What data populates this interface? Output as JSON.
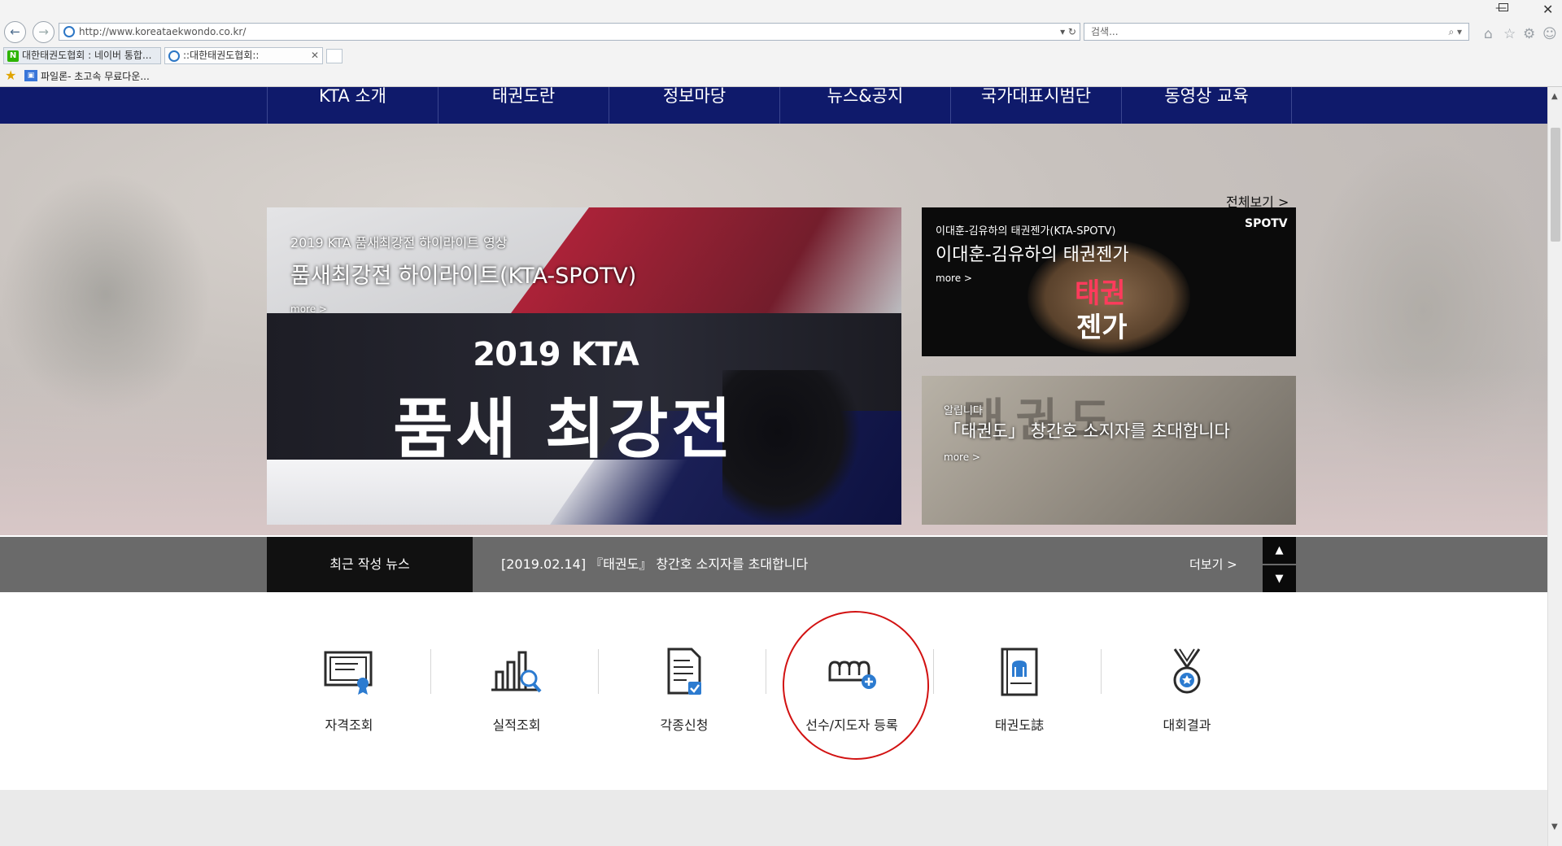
{
  "browser": {
    "url": "http://www.koreataekwondo.co.kr/",
    "search_placeholder": "검색...",
    "tabs": [
      {
        "label": "대한태권도협회 : 네이버 통합..."
      },
      {
        "label": "::대한태권도협회::"
      }
    ],
    "favorites": [
      {
        "label": "파일론- 초고속 무료다운..."
      }
    ]
  },
  "nav": {
    "items": [
      "KTA 소개",
      "태권도란",
      "정보마당",
      "뉴스&공지",
      "국가대표시범단",
      "동영상 교육"
    ]
  },
  "hero": {
    "view_all": "전체보기 >",
    "main": {
      "subtitle": "2019 KTA 품새최강전 하이라이트 영상",
      "title": "품새최강전 하이라이트(KTA-SPOTV)",
      "more": "more >",
      "graphic_line1": "2019 KTA",
      "graphic_line2": "품새 최강전"
    },
    "side1": {
      "logo": "SPOTV",
      "subtitle": "이대훈-김유하의 태권젠가(KTA-SPOTV)",
      "title": "이대훈-김유하의 태권젠가",
      "more": "more >",
      "art_line1": "태권",
      "art_line2": "젠가"
    },
    "side2": {
      "ghost": "태권도",
      "subtitle": "알립니다",
      "title": "「태권도」 창간호 소지자를 초대합니다",
      "more": "more >"
    }
  },
  "news": {
    "label": "최근 작성 뉴스",
    "item": "[2019.02.14] 『태권도』 창간호 소지자를 초대합니다",
    "more": "더보기 >"
  },
  "quick_menu": [
    {
      "label": "자격조회",
      "icon": "certificate-icon"
    },
    {
      "label": "실적조회",
      "icon": "bar-chart-search-icon"
    },
    {
      "label": "각종신청",
      "icon": "document-check-icon"
    },
    {
      "label": "선수/지도자 등록",
      "icon": "fist-plus-icon"
    },
    {
      "label": "태권도誌",
      "icon": "magazine-icon"
    },
    {
      "label": "대회결과",
      "icon": "medal-icon"
    }
  ],
  "colors": {
    "nav_bg": "#0f1a6b",
    "annotation": "#d21212",
    "icon_accent": "#2c7bd0"
  }
}
